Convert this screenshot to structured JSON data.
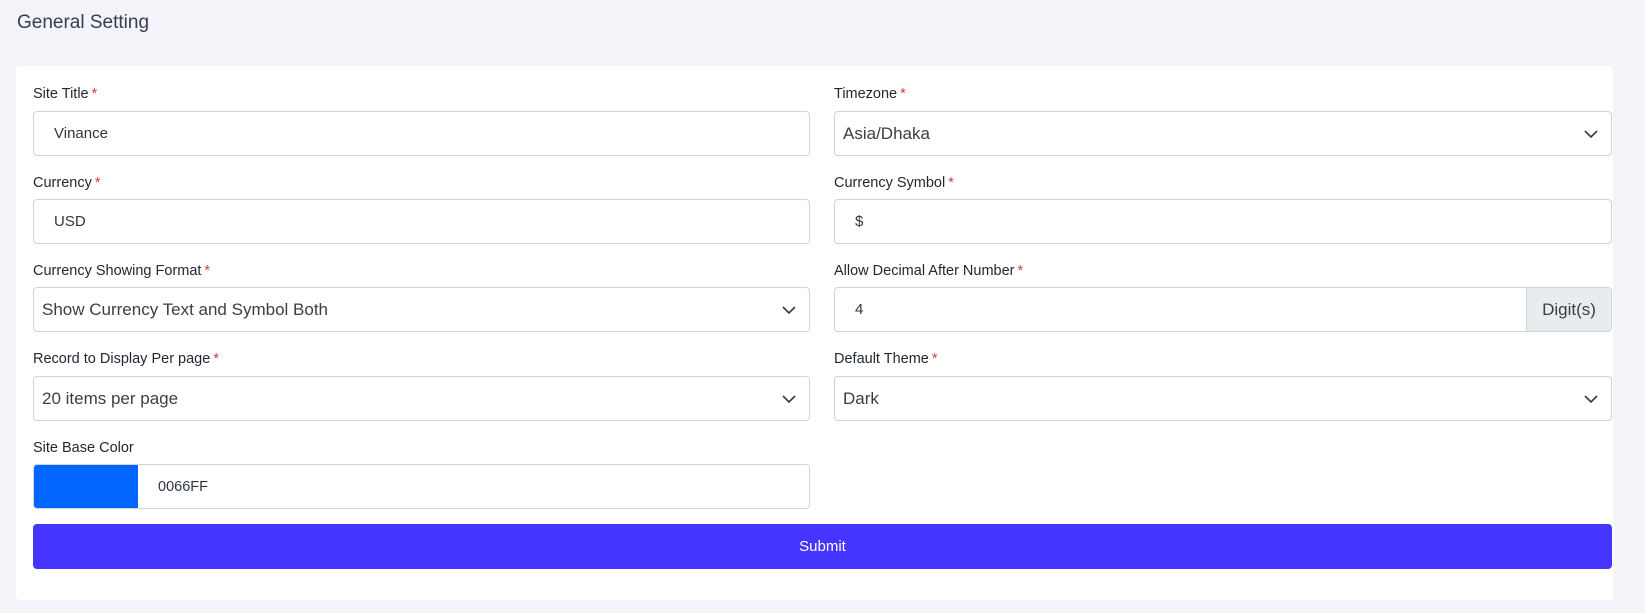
{
  "page": {
    "title": "General Setting"
  },
  "form": {
    "site_title": {
      "label": "Site Title",
      "required": "*",
      "value": "Vinance"
    },
    "timezone": {
      "label": "Timezone",
      "required": "*",
      "value": "Asia/Dhaka"
    },
    "currency": {
      "label": "Currency",
      "required": "*",
      "value": "USD"
    },
    "currency_symbol": {
      "label": "Currency Symbol",
      "required": "*",
      "value": "$"
    },
    "currency_format": {
      "label": "Currency Showing Format",
      "required": "*",
      "value": "Show Currency Text and Symbol Both"
    },
    "decimal": {
      "label": "Allow Decimal After Number",
      "required": "*",
      "value": "4",
      "addon": "Digit(s)"
    },
    "per_page": {
      "label": "Record to Display Per page",
      "required": "*",
      "value": "20 items per page"
    },
    "theme": {
      "label": "Default Theme",
      "required": "*",
      "value": "Dark"
    },
    "base_color": {
      "label": "Site Base Color",
      "value": "0066FF",
      "swatch": "#0066FF"
    },
    "submit_label": "Submit"
  },
  "colors": {
    "submit_bg": "#4634FF",
    "required": "#e53935"
  },
  "icons": {
    "select": "chevron-down-icon"
  }
}
